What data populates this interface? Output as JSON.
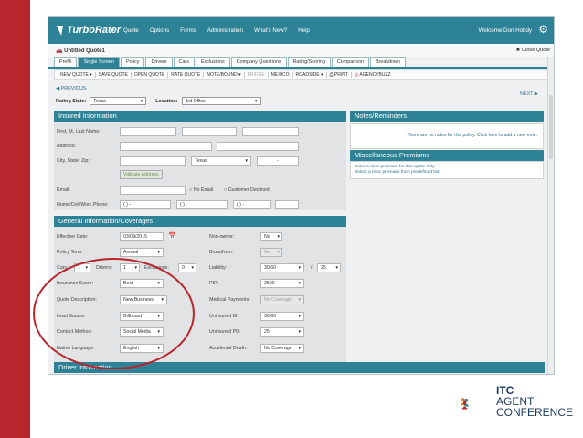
{
  "app": {
    "logo_text": "TurboRater",
    "nav": [
      "Quote",
      "Options",
      "Forms",
      "Administration",
      "What's New?",
      "Help"
    ],
    "welcome": "Welcome Don Hobdy",
    "quote_title": "Untitled Quote1",
    "close_quote": "Close Quote"
  },
  "tabs": [
    {
      "label": "Prefill",
      "active": false
    },
    {
      "label": "Single Screen",
      "active": true
    },
    {
      "label": "Policy",
      "active": false
    },
    {
      "label": "Drivers",
      "active": false
    },
    {
      "label": "Cars",
      "active": false
    },
    {
      "label": "Exclusions",
      "active": false
    },
    {
      "label": "Company Questions",
      "active": false
    },
    {
      "label": "Rating/Scoring",
      "active": false
    },
    {
      "label": "Comparison",
      "active": false
    },
    {
      "label": "Breakdown",
      "active": false
    }
  ],
  "toolbar": [
    "NEW QUOTE ▾",
    "SAVE QUOTE",
    "OPEN QUOTE",
    "RATE QUOTE",
    "NOTE/BOUND ▾",
    "BRIDGE",
    "MEXICO",
    "ROADSIDE ▾",
    "PRINT",
    "AGENCYBUZZ"
  ],
  "toolbar_dim": [
    false,
    false,
    false,
    false,
    false,
    true,
    false,
    false,
    false,
    false
  ],
  "previous": "PREVIOUS",
  "next": "NEXT",
  "rating": {
    "state_label": "Rating State:",
    "state": "Texas",
    "location_label": "Location:",
    "location": "3rd Office"
  },
  "insured": {
    "header": "Insured Information",
    "name_label": "First, M, Last Name:",
    "address_label": "Address:",
    "city_label": "City, State, Zip:",
    "state_value": "Texas",
    "zip_dash": "-",
    "validate": "Validate Address",
    "email_label": "Email:",
    "no_email": "No Email",
    "customer_declined": "Customer Declined",
    "phone_label": "Home/Cell/Work Phone:",
    "phone_mask": "( )  -"
  },
  "notes": {
    "header": "Notes/Reminders",
    "text": "There are no notes for this policy.",
    "link": "Click here",
    "text2": "to add a new note."
  },
  "misc": {
    "header": "Miscellaneous Premiums",
    "line1": "Enter a misc premium for this quote only",
    "line2": "Select a misc premium from predefined list"
  },
  "general": {
    "header": "General Information/Coverages",
    "effective_label": "Effective Date:",
    "effective": "03/09/2015",
    "term_label": "Policy Term:",
    "term": "Annual",
    "cars_label": "Cars:",
    "cars": "1",
    "drivers_label": "Drivers:",
    "drivers": "1",
    "exclusions_label": "Exclusions:",
    "exclusions": "0",
    "insurance_score_label": "Insurance Score:",
    "insurance_score": "Best",
    "quote_desc_label": "Quote Description:",
    "quote_desc": "New Business",
    "lead_source_label": "Lead Source:",
    "lead_source": "Billboard",
    "contact_label": "Contact Method:",
    "contact": "Social Media",
    "language_label": "Native Language:",
    "language": "English",
    "nonowner_label": "Non-owner:",
    "nonowner": "No",
    "broadform_label": "Broadform:",
    "broadform": "No",
    "liability_label": "Liability:",
    "liability": "30/60",
    "liability2": "25",
    "pip_label": "PIP:",
    "pip": "2500",
    "medpay_label": "Medical Payments:",
    "medpay": "No Coverage",
    "ubi_label": "Uninsured BI:",
    "ubi": "30/60",
    "upd_label": "Uninsured PD:",
    "upd": "25",
    "accdeath_label": "Accidental Death:",
    "accdeath": "No Coverage"
  },
  "driver_header": "Driver Information",
  "brand": {
    "line1": "ITC",
    "line2": "AGENT",
    "line3": "CONFERENCE"
  },
  "colors": {
    "accent": "#2e8296",
    "red": "#b8262d"
  }
}
